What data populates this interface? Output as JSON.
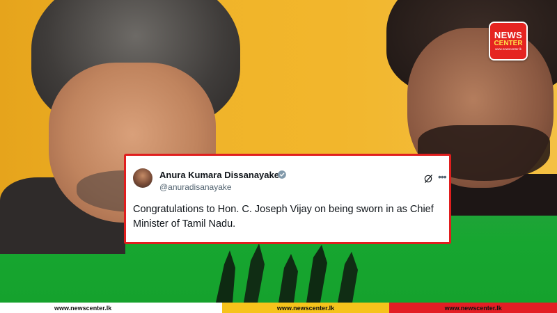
{
  "logo": {
    "line1": "NEWS",
    "line2": "CENTER",
    "line3": "www.newscenter.lk"
  },
  "tweet": {
    "author_name": "Anura Kumara Dissanayake",
    "author_handle": "@anuradisanayake",
    "text": "Congratulations to Hon. C. Joseph Vijay on being sworn in as Chief Minister of Tamil Nadu."
  },
  "footer": {
    "left": "www.newscenter.lk",
    "center": "www.newscenter.lk",
    "right": "www.newscenter.lk"
  },
  "colors": {
    "card_border": "#e01e1e",
    "footer_yellow": "#f6c31b",
    "footer_red": "#e31e24",
    "bg_green": "#17a630",
    "bg_yellow": "#f0b429"
  },
  "icons": [
    "verified-badge-icon",
    "x-logo-icon",
    "more-options-icon"
  ]
}
